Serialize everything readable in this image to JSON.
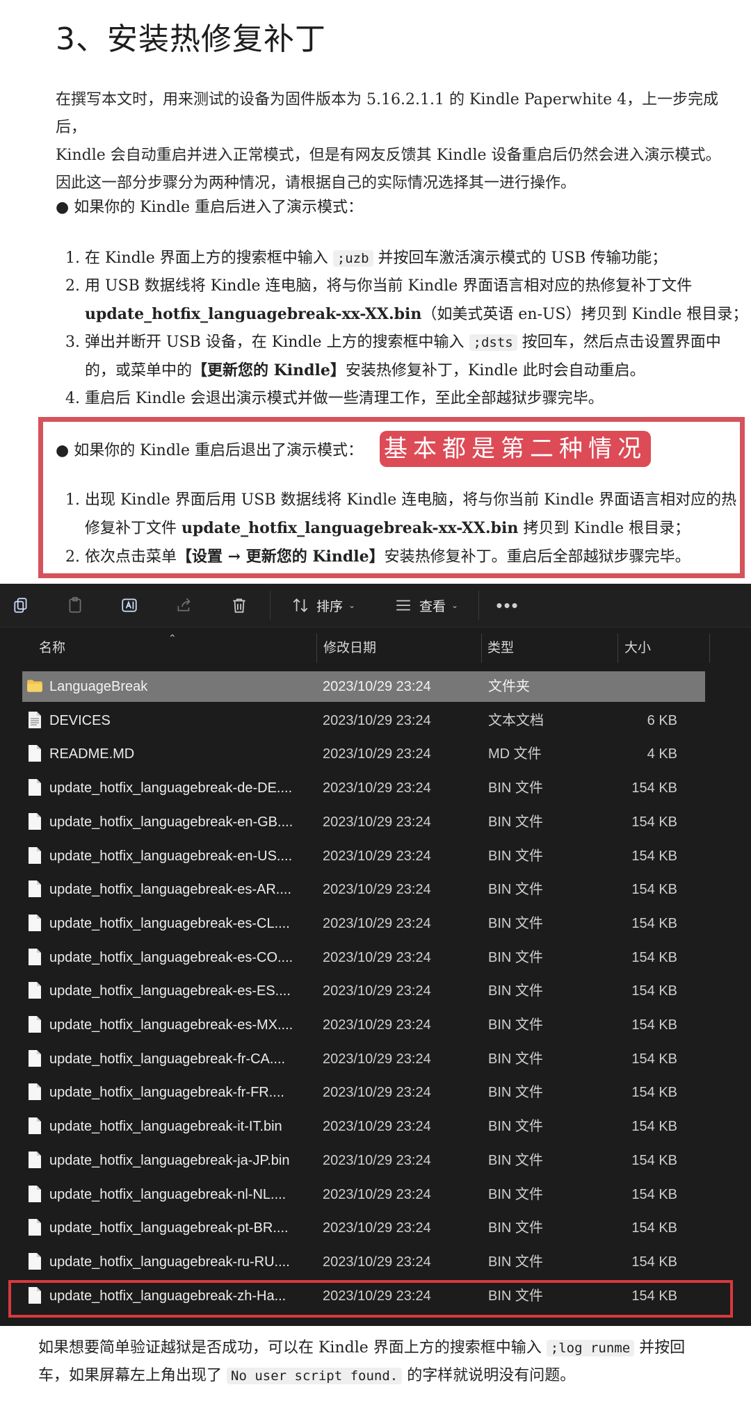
{
  "article": {
    "heading": "3、安装热修复补丁",
    "intro": [
      "在撰写本文时，用来测试的设备为固件版本为 5.16.2.1.1 的 Kindle Paperwhite 4，上一步完成后，",
      "Kindle 会自动重启并进入正常模式，但是有网友反馈其 Kindle 设备重启后仍然会进入演示模式。",
      "因此这一部分步骤分为两种情况，请根据自己的实际情况选择其一进行操作。"
    ],
    "case1": {
      "title": "● 如果你的 Kindle 重启后进入了演示模式：",
      "s1_a": "在 Kindle 界面上方的搜索框中输入 ",
      "s1_code": ";uzb",
      "s1_b": " 并按回车激活演示模式的 USB 传输功能；",
      "s2_a": "用 USB 数据线将 Kindle 连电脑，将与你当前 Kindle 界面语言相对应的热修复补丁文件",
      "s2_file": "update_hotfix_languagebreak-xx-XX.bin",
      "s2_b": "（如美式英语 en-US）拷贝到 Kindle 根目录；",
      "s3_a": "弹出并断开 USB 设备，在 Kindle 上方的搜索框中输入 ",
      "s3_code": ";dsts",
      "s3_b": " 按回车，然后点击设置界面中",
      "s3_c": "的，或菜单中的",
      "s3_bold": "【更新您的 Kindle】",
      "s3_d": "安装热修复补丁，Kindle 此时会自动重启。",
      "s4": "重启后 Kindle 会退出演示模式并做一些清理工作，至此全部越狱步骤完毕。"
    },
    "case2": {
      "title": "● 如果你的 Kindle 重启后退出了演示模式：",
      "stamp": "基本都是第二种情况",
      "s1_a": "出现 Kindle 界面后用 USB 数据线将 Kindle 连电脑，将与你当前 Kindle 界面语言相对应的热",
      "s1_b": "修复补丁文件 ",
      "s1_file": "update_hotfix_languagebreak-xx-XX.bin",
      "s1_c": " 拷贝到 Kindle 根目录；",
      "s2_a": "依次点击菜单",
      "s2_bold": "【设置 → 更新您的 Kindle】",
      "s2_b": "安装热修复补丁。重启后全部越狱步骤完毕。"
    },
    "outro": {
      "a": "如果想要简单验证越狱是否成功，可以在 Kindle 界面上方的搜索框中输入 ",
      "code1": ";log runme",
      "b": " 并按回",
      "c": "车，如果屏幕左上角出现了 ",
      "code2": "No user script found.",
      "d": " 的字样就说明没有问题。"
    },
    "accent_color": "#d5535b"
  },
  "explorer": {
    "toolbar": {
      "sort_label": "排序",
      "view_label": "查看",
      "icons": [
        "copy-icon",
        "paste-icon",
        "rename-icon",
        "share-icon",
        "delete-icon",
        "sort-icon",
        "view-icon",
        "more-icon"
      ]
    },
    "columns": {
      "name": "名称",
      "date": "修改日期",
      "type": "类型",
      "size": "大小"
    },
    "files": [
      {
        "name": "LanguageBreak",
        "date": "2023/10/29 23:24",
        "type": "文件夹",
        "size": "",
        "kind": "folder"
      },
      {
        "name": "DEVICES",
        "date": "2023/10/29 23:24",
        "type": "文本文档",
        "size": "6 KB",
        "kind": "text"
      },
      {
        "name": "README.MD",
        "date": "2023/10/29 23:24",
        "type": "MD 文件",
        "size": "4 KB",
        "kind": "file"
      },
      {
        "name": "update_hotfix_languagebreak-de-DE....",
        "date": "2023/10/29 23:24",
        "type": "BIN 文件",
        "size": "154 KB",
        "kind": "file"
      },
      {
        "name": "update_hotfix_languagebreak-en-GB....",
        "date": "2023/10/29 23:24",
        "type": "BIN 文件",
        "size": "154 KB",
        "kind": "file"
      },
      {
        "name": "update_hotfix_languagebreak-en-US....",
        "date": "2023/10/29 23:24",
        "type": "BIN 文件",
        "size": "154 KB",
        "kind": "file"
      },
      {
        "name": "update_hotfix_languagebreak-es-AR....",
        "date": "2023/10/29 23:24",
        "type": "BIN 文件",
        "size": "154 KB",
        "kind": "file"
      },
      {
        "name": "update_hotfix_languagebreak-es-CL....",
        "date": "2023/10/29 23:24",
        "type": "BIN 文件",
        "size": "154 KB",
        "kind": "file"
      },
      {
        "name": "update_hotfix_languagebreak-es-CO....",
        "date": "2023/10/29 23:24",
        "type": "BIN 文件",
        "size": "154 KB",
        "kind": "file"
      },
      {
        "name": "update_hotfix_languagebreak-es-ES....",
        "date": "2023/10/29 23:24",
        "type": "BIN 文件",
        "size": "154 KB",
        "kind": "file"
      },
      {
        "name": "update_hotfix_languagebreak-es-MX....",
        "date": "2023/10/29 23:24",
        "type": "BIN 文件",
        "size": "154 KB",
        "kind": "file"
      },
      {
        "name": "update_hotfix_languagebreak-fr-CA....",
        "date": "2023/10/29 23:24",
        "type": "BIN 文件",
        "size": "154 KB",
        "kind": "file"
      },
      {
        "name": "update_hotfix_languagebreak-fr-FR....",
        "date": "2023/10/29 23:24",
        "type": "BIN 文件",
        "size": "154 KB",
        "kind": "file"
      },
      {
        "name": "update_hotfix_languagebreak-it-IT.bin",
        "date": "2023/10/29 23:24",
        "type": "BIN 文件",
        "size": "154 KB",
        "kind": "file"
      },
      {
        "name": "update_hotfix_languagebreak-ja-JP.bin",
        "date": "2023/10/29 23:24",
        "type": "BIN 文件",
        "size": "154 KB",
        "kind": "file"
      },
      {
        "name": "update_hotfix_languagebreak-nl-NL....",
        "date": "2023/10/29 23:24",
        "type": "BIN 文件",
        "size": "154 KB",
        "kind": "file"
      },
      {
        "name": "update_hotfix_languagebreak-pt-BR....",
        "date": "2023/10/29 23:24",
        "type": "BIN 文件",
        "size": "154 KB",
        "kind": "file"
      },
      {
        "name": "update_hotfix_languagebreak-ru-RU....",
        "date": "2023/10/29 23:24",
        "type": "BIN 文件",
        "size": "154 KB",
        "kind": "file"
      },
      {
        "name": "update_hotfix_languagebreak-zh-Ha...",
        "date": "2023/10/29 23:24",
        "type": "BIN 文件",
        "size": "154 KB",
        "kind": "file"
      }
    ],
    "selected_row": "LanguageBreak",
    "highlighted_row": "update_hotfix_languagebreak-zh-Ha..."
  }
}
